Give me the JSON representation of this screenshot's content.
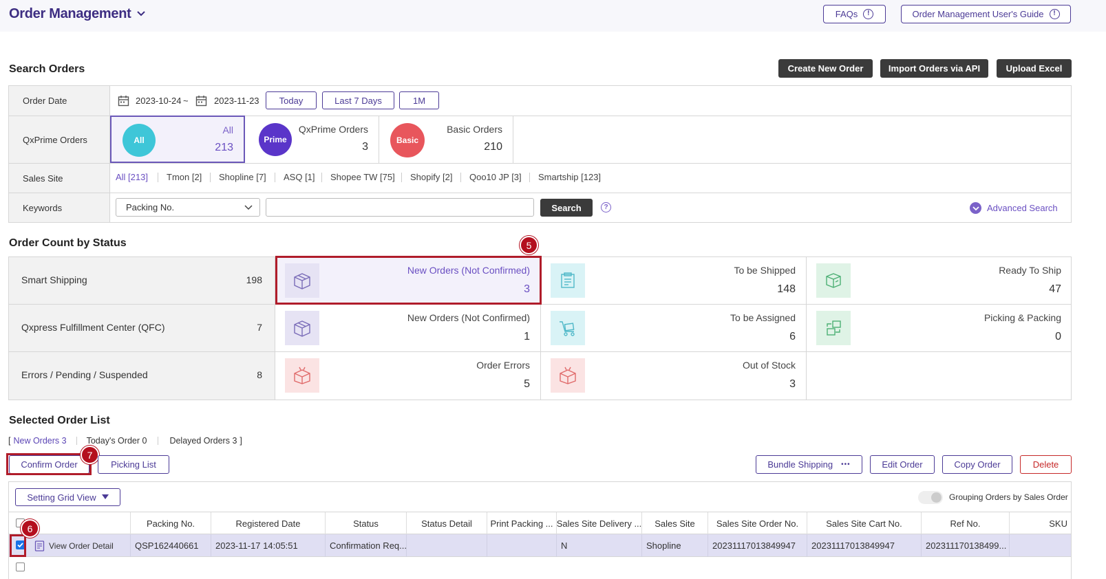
{
  "header": {
    "title": "Order Management",
    "faq_label": "FAQs",
    "guide_label": "Order Management User's Guide"
  },
  "search": {
    "title": "Search Orders",
    "create_label": "Create New Order",
    "import_label": "Import Orders via API",
    "upload_label": "Upload Excel",
    "order_date_label": "Order Date",
    "date_from": "2023-10-24",
    "date_tilde": "~",
    "date_to": "2023-11-23",
    "today_label": "Today",
    "last7_label": "Last 7 Days",
    "onem_label": "1M",
    "qxprime_label": "QxPrime Orders",
    "prime_boxes": [
      {
        "circle": "All",
        "label": "All",
        "count": "213",
        "color": "#3ec6d8"
      },
      {
        "circle": "Prime",
        "label": "QxPrime Orders",
        "count": "3",
        "color": "#5a35c9"
      },
      {
        "circle": "Basic",
        "label": "Basic Orders",
        "count": "210",
        "color": "#e8565c"
      }
    ],
    "sales_site_label": "Sales Site",
    "sites": [
      "All [213]",
      "Tmon [2]",
      "Shopline [7]",
      "ASQ [1]",
      "Shopee TW [75]",
      "Shopify [2]",
      "Qoo10 JP [3]",
      "Smartship [123]"
    ],
    "keywords_label": "Keywords",
    "keyword_type": "Packing No.",
    "keyword_value": "",
    "search_label": "Search",
    "help_glyph": "?",
    "advanced_label": "Advanced Search"
  },
  "status": {
    "title": "Order Count by Status",
    "rows": [
      {
        "name": "Smart Shipping",
        "count": "198",
        "cells": [
          {
            "label": "New Orders (Not Confirmed)",
            "value": "3",
            "icon": "box-icon",
            "tint": "#e6e3f4",
            "stroke": "#7a6cb8"
          },
          {
            "label": "To be Shipped",
            "value": "148",
            "icon": "document-icon",
            "tint": "#d9f3f6",
            "stroke": "#4fb8c8"
          },
          {
            "label": "Ready To Ship",
            "value": "47",
            "icon": "package-icon",
            "tint": "#dff3e6",
            "stroke": "#4caf74"
          }
        ]
      },
      {
        "name": "Qxpress Fulfillment Center (QFC)",
        "count": "7",
        "cells": [
          {
            "label": "New Orders (Not Confirmed)",
            "value": "1",
            "icon": "box-icon",
            "tint": "#e6e3f4",
            "stroke": "#7a6cb8"
          },
          {
            "label": "To be Assigned",
            "value": "6",
            "icon": "cart-icon",
            "tint": "#d9f3f6",
            "stroke": "#4fb8c8"
          },
          {
            "label": "Picking & Packing",
            "value": "0",
            "icon": "packing-icon",
            "tint": "#dff3e6",
            "stroke": "#4caf74"
          }
        ]
      },
      {
        "name": "Errors / Pending / Suspended",
        "count": "8",
        "cells": [
          {
            "label": "Order Errors",
            "value": "5",
            "icon": "error-box-icon",
            "tint": "#fbe3e3",
            "stroke": "#e06a6a"
          },
          {
            "label": "Out of Stock",
            "value": "3",
            "icon": "error-box-icon",
            "tint": "#fbe3e3",
            "stroke": "#e06a6a"
          }
        ]
      }
    ]
  },
  "order_list": {
    "title": "Selected Order List",
    "open_bracket": "[",
    "close_bracket": "]",
    "tabs": [
      "New Orders 3",
      "Today's Order 0",
      "Delayed Orders 3"
    ],
    "confirm_label": "Confirm Order",
    "picking_label": "Picking List",
    "bundle_label": "Bundle Shipping",
    "bundle_more": "•••",
    "edit_label": "Edit Order",
    "copy_label": "Copy Order",
    "delete_label": "Delete",
    "grid_view_label": "Setting Grid View",
    "grouping_label": "Grouping Orders by Sales Order",
    "columns": [
      "Packing No.",
      "Registered Date",
      "Status",
      "Status Detail",
      "Print Packing ...",
      "Sales Site Delivery ...",
      "Sales Site",
      "Sales Site Order No.",
      "Sales Site Cart No.",
      "Ref No.",
      "SKU"
    ],
    "row": {
      "detail_label": "View Order Detail",
      "cells": [
        "QSP162440661",
        "2023-11-17 14:05:51",
        "Confirmation Req...",
        "",
        "",
        "N",
        "Shopline",
        "20231117013849947",
        "20231117013849947",
        "202311170138499...",
        ""
      ]
    }
  },
  "annotations": {
    "five": "5",
    "six": "6",
    "seven": "7"
  },
  "colors": {
    "accent": "#4b3a96",
    "highlight": "#b01c2a",
    "selected_row": "#e0dff3"
  }
}
